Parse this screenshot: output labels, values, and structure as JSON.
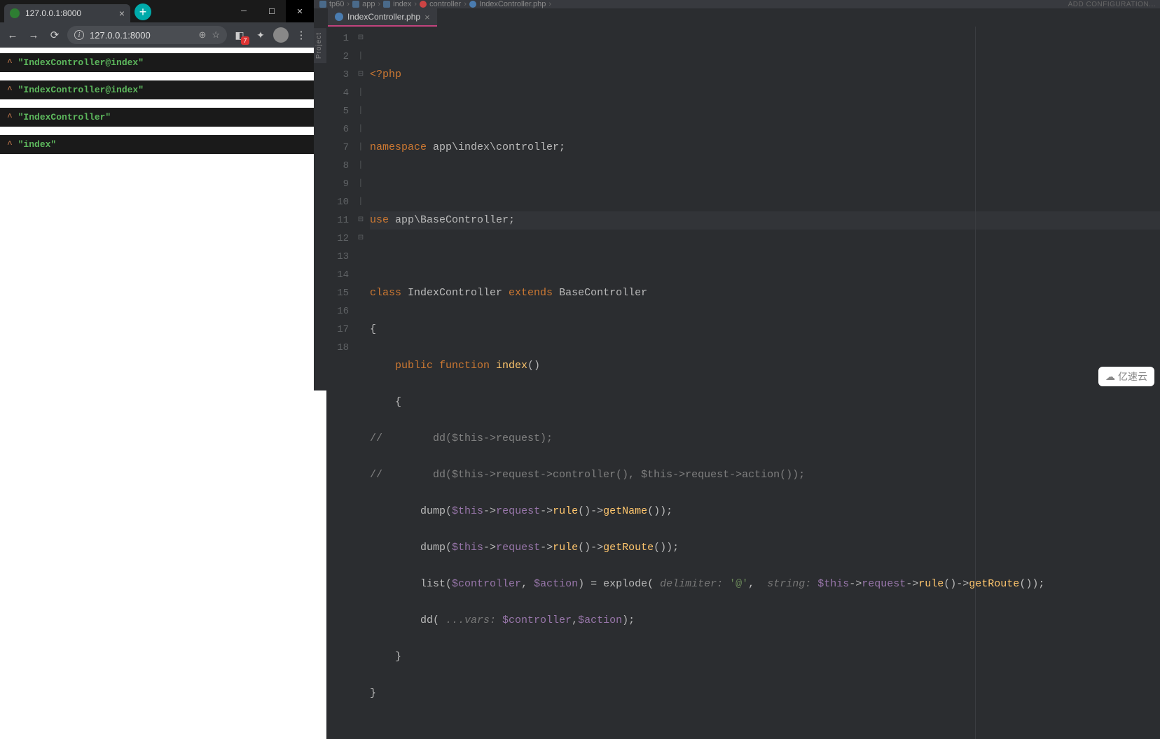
{
  "browser": {
    "tab_title": "127.0.0.1:8000",
    "url": "127.0.0.1:8000",
    "ext_badge": "7",
    "dumps": [
      "\"IndexController@index\"",
      "\"IndexController@index\"",
      "\"IndexController\"",
      "\"index\""
    ]
  },
  "ide": {
    "add_config": "ADD CONFIGURATION...",
    "project_label": "Project",
    "breadcrumb": [
      "tp60",
      "app",
      "index",
      "controller",
      "IndexController.php"
    ],
    "tab_name": "IndexController.php",
    "line_count": 18,
    "code": {
      "l1_open": "<?php",
      "l3_ns": "namespace",
      "l3_path": " app\\index\\controller;",
      "l5_use": "use",
      "l5_path": " app\\BaseController;",
      "l7_class": "class",
      "l7_name": " IndexController ",
      "l7_ext": "extends",
      "l7_base": " BaseController",
      "l8": "{",
      "l9_pub": "    public",
      "l9_fn": " function ",
      "l9_name": "index",
      "l9_par": "()",
      "l10": "    {",
      "l11": "//        dd($this->request);",
      "l12": "//        dd($this->request->controller(), $this->request->action());",
      "l13a": "        dump(",
      "l13b": "$this",
      "l13c": "->",
      "l13d": "request",
      "l13e": "->",
      "l13f": "rule",
      "l13g": "()->",
      "l13h": "getName",
      "l13i": "());",
      "l14a": "        dump(",
      "l14b": "$this",
      "l14c": "->",
      "l14d": "request",
      "l14e": "->",
      "l14f": "rule",
      "l14g": "()->",
      "l14h": "getRoute",
      "l14i": "());",
      "l15a": "        list(",
      "l15b": "$controller",
      "l15c": ", ",
      "l15d": "$action",
      "l15e": ") = explode( ",
      "l15h1": "delimiter: ",
      "l15s1": "'@'",
      "l15f": ",  ",
      "l15h2": "string: ",
      "l15g": "$this",
      "l15h": "->",
      "l15i": "request",
      "l15j": "->",
      "l15k": "rule",
      "l15l": "()->",
      "l15m": "getRoute",
      "l15n": "());",
      "l16a": "        dd( ",
      "l16h": "...vars: ",
      "l16b": "$controller",
      "l16c": ",",
      "l16d": "$action",
      "l16e": ");",
      "l17": "    }",
      "l18": "}"
    }
  },
  "watermark": "亿速云"
}
